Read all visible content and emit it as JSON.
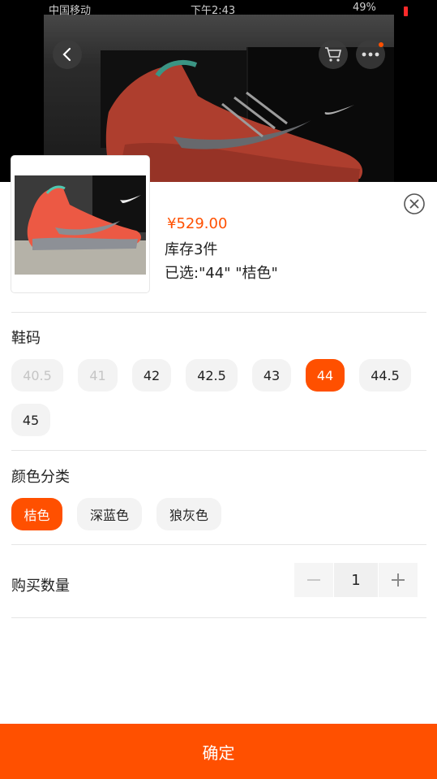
{
  "status_bar": {
    "carrier": "中国移动",
    "time": "下午2:43",
    "battery": "49%"
  },
  "nav": {
    "back_icon": "chevron-left-icon",
    "cart_icon": "cart-icon",
    "more_icon": "more-icon"
  },
  "product": {
    "price": "¥529.00",
    "stock": "库存3件",
    "selected": "已选:\"44\" \"桔色\""
  },
  "size_section": {
    "title": "鞋码",
    "options": [
      {
        "label": "40.5",
        "state": "disabled"
      },
      {
        "label": "41",
        "state": "disabled"
      },
      {
        "label": "42",
        "state": "normal"
      },
      {
        "label": "42.5",
        "state": "normal"
      },
      {
        "label": "43",
        "state": "normal"
      },
      {
        "label": "44",
        "state": "selected"
      },
      {
        "label": "44.5",
        "state": "normal"
      },
      {
        "label": "45",
        "state": "normal"
      }
    ]
  },
  "color_section": {
    "title": "颜色分类",
    "options": [
      {
        "label": "桔色",
        "state": "selected"
      },
      {
        "label": "深蓝色",
        "state": "normal"
      },
      {
        "label": "狼灰色",
        "state": "normal"
      }
    ]
  },
  "quantity": {
    "label": "购买数量",
    "value": "1"
  },
  "confirm_label": "确定",
  "colors": {
    "accent": "#ff5000",
    "chip_bg": "#f3f3f3",
    "disabled_text": "#c5c5c5"
  }
}
